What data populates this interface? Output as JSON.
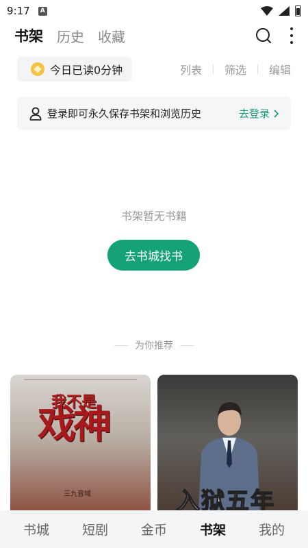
{
  "status": {
    "time": "9:17",
    "notification_letter": "A"
  },
  "header": {
    "tabs": [
      {
        "label": "书架",
        "active": true
      },
      {
        "label": "历史",
        "active": false
      },
      {
        "label": "收藏",
        "active": false
      }
    ]
  },
  "toolbar": {
    "reading_today": "今日已读0分钟",
    "list_label": "列表",
    "filter_label": "筛选",
    "edit_label": "编辑"
  },
  "login_bar": {
    "message": "登录即可永久保存书架和浏览历史",
    "link": "去登录"
  },
  "empty": {
    "message": "书架暂无书籍",
    "button": "去书城找书"
  },
  "recommend": {
    "title": "为你推荐",
    "books": [
      {
        "cover_small": "我不是",
        "cover_big": "戏神",
        "cover_author": "三九音域"
      },
      {
        "cover_big": "入狱五年"
      }
    ]
  },
  "bottom_nav": [
    {
      "label": "书城",
      "active": false
    },
    {
      "label": "短剧",
      "active": false
    },
    {
      "label": "金币",
      "active": false
    },
    {
      "label": "书架",
      "active": true
    },
    {
      "label": "我的",
      "active": false
    }
  ],
  "colors": {
    "accent": "#14a276",
    "link": "#1aa073",
    "coin": "#f5c343"
  }
}
